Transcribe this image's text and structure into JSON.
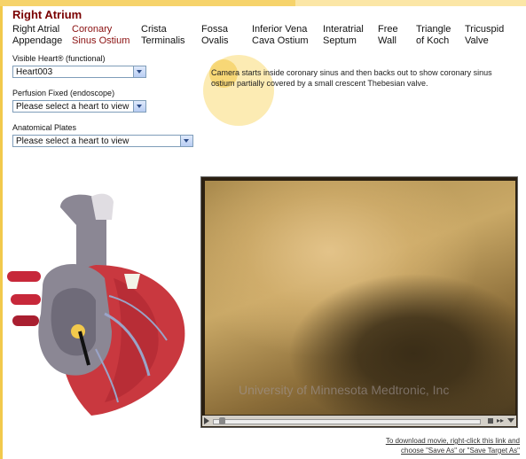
{
  "page": {
    "title": "Right Atrium"
  },
  "nav": {
    "items": [
      {
        "line1": "Right Atrial",
        "line2": "Appendage",
        "active": false
      },
      {
        "line1": "Coronary",
        "line2": "Sinus Ostium",
        "active": true
      },
      {
        "line1": "Crista",
        "line2": "Terminalis",
        "active": false
      },
      {
        "line1": "Fossa",
        "line2": "Ovalis",
        "active": false
      },
      {
        "line1": "Inferior Vena",
        "line2": "Cava Ostium",
        "active": false
      },
      {
        "line1": "Interatrial",
        "line2": "Septum",
        "active": false
      },
      {
        "line1": "Free",
        "line2": "Wall",
        "active": false
      },
      {
        "line1": "Triangle",
        "line2": "of Koch",
        "active": false
      },
      {
        "line1": "Tricuspid",
        "line2": "Valve",
        "active": false
      }
    ]
  },
  "controls": {
    "visible_heart": {
      "label": "Visible Heart® (functional)",
      "value": "Heart003"
    },
    "perfusion_fixed": {
      "label": "Perfusion Fixed (endoscope)",
      "value": "Please select a heart to view"
    },
    "anatomical_plates": {
      "label": "Anatomical Plates",
      "value": "Please select a heart to view"
    }
  },
  "description": "Camera starts inside coronary sinus and then backs out to show coronary sinus ostium partially covered by a small crescent Thebesian valve.",
  "video": {
    "watermark": "University of Minnesota Medtronic, Inc",
    "progress": 0.02
  },
  "download": {
    "line1": "To download movie, right-click this link and",
    "line2": "choose \"Save As\" or \"Save Target As\""
  },
  "colors": {
    "accent": "#7a0000",
    "active_nav": "#8a0f0f",
    "highlight": "#f6d36b"
  }
}
